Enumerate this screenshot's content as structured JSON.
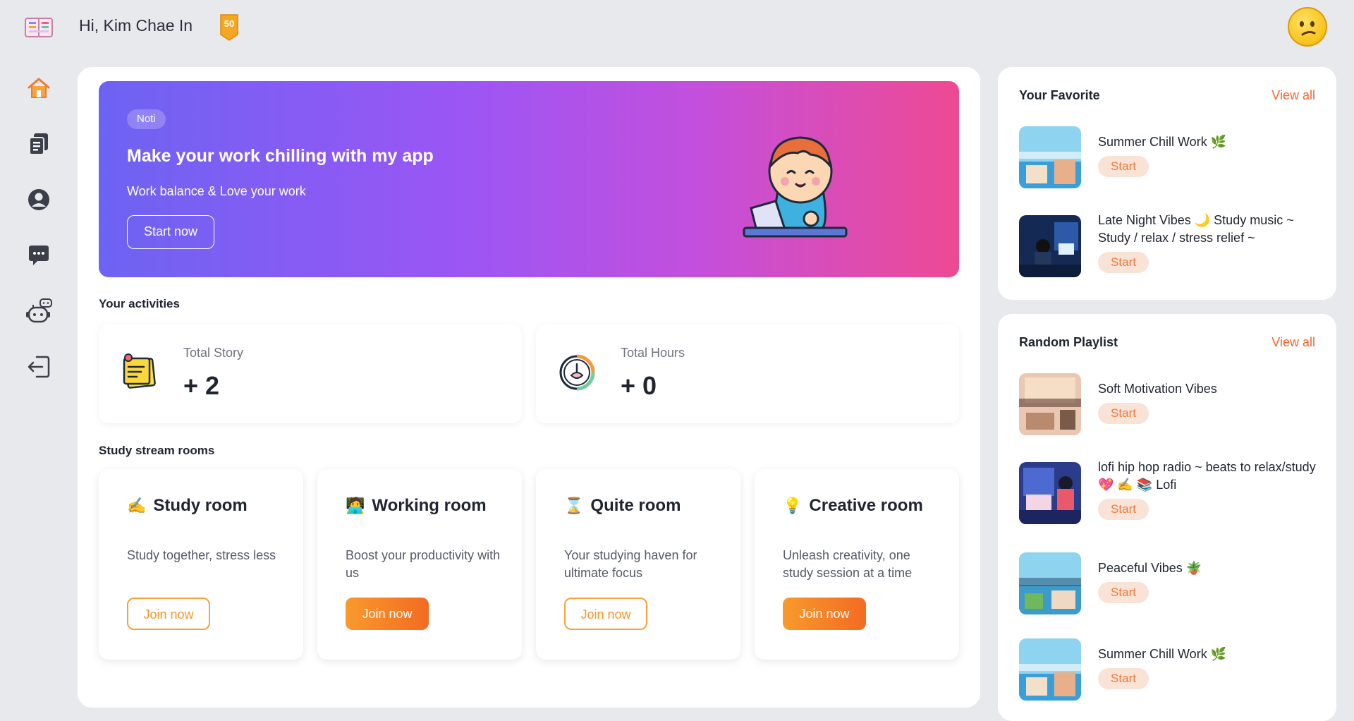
{
  "header": {
    "greeting": "Hi, Kim Chae In",
    "level": "50"
  },
  "sidebar": {
    "items": [
      {
        "icon": "home-icon"
      },
      {
        "icon": "notes-icon"
      },
      {
        "icon": "profile-icon"
      },
      {
        "icon": "chat-icon"
      },
      {
        "icon": "bot-icon"
      },
      {
        "icon": "logout-icon"
      }
    ]
  },
  "banner": {
    "badge": "Noti",
    "title": "Make your work chilling with my app",
    "subtitle": "Work balance & Love your work",
    "button": "Start now"
  },
  "activities": {
    "title": "Your activities",
    "stats": [
      {
        "label": "Total Story",
        "value": "+ 2"
      },
      {
        "label": "Total Hours",
        "value": "+ 0"
      }
    ]
  },
  "rooms": {
    "title": "Study stream rooms",
    "items": [
      {
        "emoji": "✍️",
        "title": "Study room",
        "desc": "Study together, stress less",
        "button": "Join now"
      },
      {
        "emoji": "🧑‍💻",
        "title": "Working room",
        "desc": "Boost your productivity with us",
        "button": "Join now"
      },
      {
        "emoji": "⌛",
        "title": "Quite room",
        "desc": "Your studying haven for ultimate focus",
        "button": "Join now"
      },
      {
        "emoji": "💡",
        "title": "Creative room",
        "desc": "Unleash creativity, one study session at a time",
        "button": "Join now"
      }
    ]
  },
  "favorite": {
    "title": "Your Favorite",
    "view_all": "View all",
    "tracks": [
      {
        "title": "Summer Chill Work 🌿",
        "button": "Start"
      },
      {
        "title": "Late Night Vibes 🌙 Study music ~ Study / relax / stress relief ~",
        "button": "Start"
      }
    ]
  },
  "random": {
    "title": "Random Playlist",
    "view_all": "View all",
    "tracks": [
      {
        "title": "Soft Motivation Vibes",
        "button": "Start"
      },
      {
        "title": "lofi hip hop radio ~ beats to relax/study 💖 ✍️ 📚 Lofi",
        "button": "Start"
      },
      {
        "title": "Peaceful Vibes 🪴",
        "button": "Start"
      },
      {
        "title": "Summer Chill Work 🌿",
        "button": "Start"
      }
    ]
  },
  "colors": {
    "accent": "#f7952a",
    "link": "#f0652d",
    "banner_start": "#6d63f2",
    "banner_end": "#ee4a93"
  }
}
